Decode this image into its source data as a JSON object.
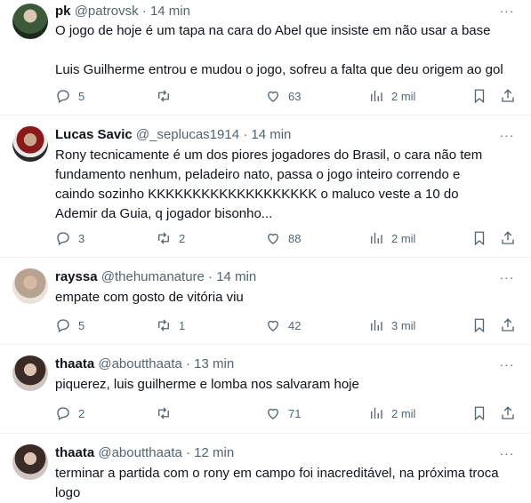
{
  "tweets": [
    {
      "name": "pk",
      "handle": "@patrovsk",
      "dot": "·",
      "time": "14 min",
      "more": "···",
      "text": "O jogo de hoje é um tapa na cara do Abel que insiste em não usar a base\n\nLuis Guilherme entrou e mudou o jogo, sofreu a falta que deu origem ao gol",
      "replies": "5",
      "retweets": "",
      "likes": "63",
      "views": "2 mil"
    },
    {
      "name": "Lucas Savic",
      "handle": "@_seplucas1914",
      "dot": "·",
      "time": "14 min",
      "more": "···",
      "text": "Rony tecnicamente é um dos piores jogadores do Brasil, o cara não tem fundamento nenhum, peladeiro nato, passa o jogo inteiro correndo e caindo sozinho KKKKKKKKKKKKKKKKKKK o maluco veste a 10 do Ademir da Guia, q jogador bisonho...",
      "replies": "3",
      "retweets": "2",
      "likes": "88",
      "views": "2 mil"
    },
    {
      "name": "rayssa",
      "handle": "@thehumanature",
      "dot": "·",
      "time": "14 min",
      "more": "···",
      "text": "empate com gosto de vitória viu",
      "replies": "5",
      "retweets": "1",
      "likes": "42",
      "views": "3 mil"
    },
    {
      "name": "thaata",
      "handle": "@aboutthaata",
      "dot": "·",
      "time": "13 min",
      "more": "···",
      "text": "piquerez, luis guilherme e lomba nos salvaram hoje",
      "replies": "2",
      "retweets": "",
      "likes": "71",
      "views": "2 mil"
    },
    {
      "name": "thaata",
      "handle": "@aboutthaata",
      "dot": "·",
      "time": "12 min",
      "more": "···",
      "text": "terminar a partida com o rony em campo foi inacreditável, na próxima troca logo"
    }
  ]
}
